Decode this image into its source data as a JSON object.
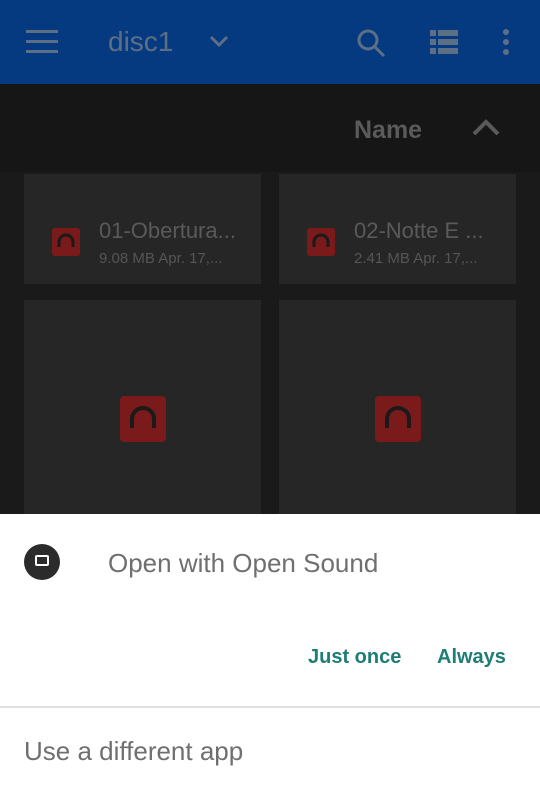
{
  "appbar": {
    "title": "disc1"
  },
  "sortbar": {
    "label": "Name"
  },
  "files": [
    {
      "name": "01-Obertura...",
      "size": "9.08 MB",
      "date": "Apr. 17,..."
    },
    {
      "name": "02-Notte E ...",
      "size": "2.41 MB",
      "date": "Apr. 17,..."
    }
  ],
  "sheet": {
    "title": "Open with Open Sound",
    "just_once": "Just once",
    "always": "Always",
    "different": "Use a different app"
  },
  "colors": {
    "appbar": "#063a80",
    "accent": "#1e7d74",
    "audio_icon": "#7a1a1a"
  }
}
